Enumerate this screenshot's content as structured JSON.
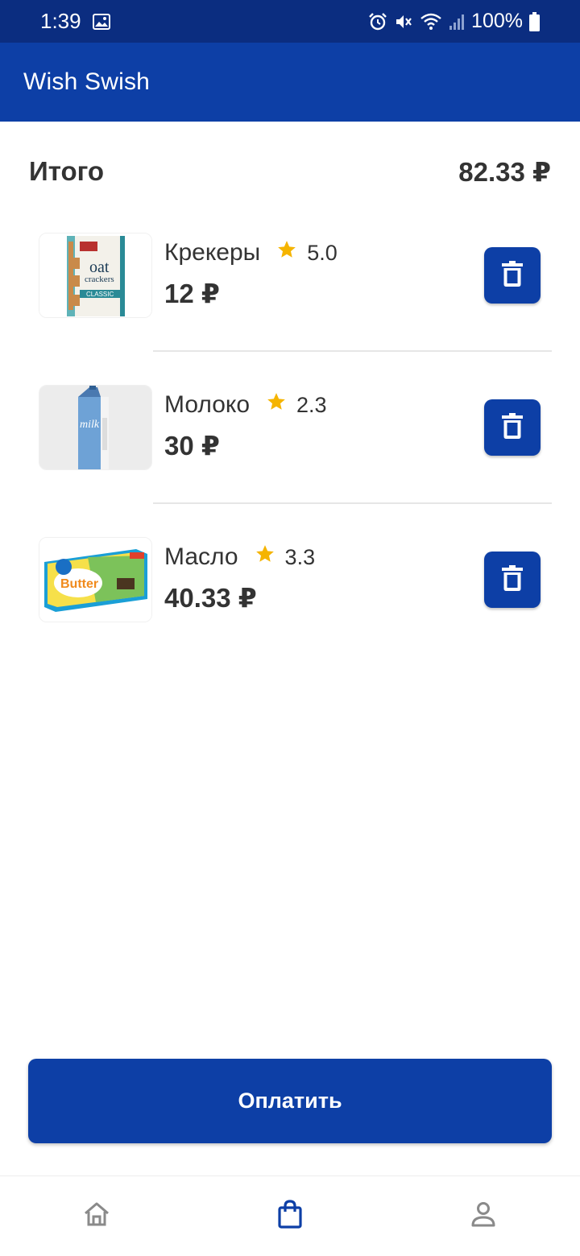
{
  "status_bar": {
    "time": "1:39",
    "battery": "100%",
    "icons": [
      "image-icon",
      "alarm-icon",
      "mute-icon",
      "wifi-icon",
      "signal-icon",
      "battery-icon"
    ]
  },
  "app": {
    "title": "Wish Swish"
  },
  "cart": {
    "total_label": "Итого",
    "total_value": "82.33 ₽",
    "items": [
      {
        "name": "Крекеры",
        "rating": "5.0",
        "price": "12 ₽",
        "image": "oat-crackers-box"
      },
      {
        "name": "Молоко",
        "rating": "2.3",
        "price": "30 ₽",
        "image": "milk-carton"
      },
      {
        "name": "Масло",
        "rating": "3.3",
        "price": "40.33 ₽",
        "image": "butter-box"
      }
    ],
    "pay_label": "Оплатить"
  },
  "bottom_nav": {
    "items": [
      {
        "icon": "home-icon",
        "active": false
      },
      {
        "icon": "shopping-bag-icon",
        "active": true
      },
      {
        "icon": "profile-icon",
        "active": false
      }
    ]
  },
  "colors": {
    "status_bar": "#0b2d80",
    "primary": "#0d3fa6",
    "star": "#f5b400",
    "text": "#333333",
    "nav_inactive": "#8a8a8a"
  }
}
